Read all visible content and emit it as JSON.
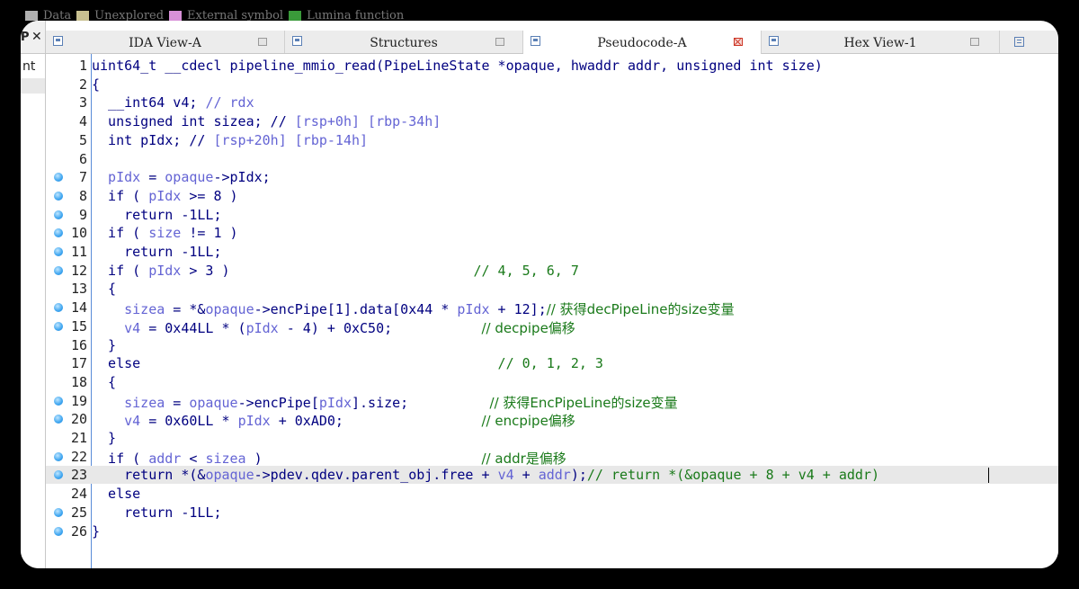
{
  "legend": [
    {
      "label": "Data",
      "color": "#b0b0b0"
    },
    {
      "label": "Unexplored",
      "color": "#c8c090"
    },
    {
      "label": "External symbol",
      "color": "#d890d8"
    },
    {
      "label": "Lumina function",
      "color": "#3a9a3a"
    }
  ],
  "left_pane": {
    "header_p": "P",
    "header_x": "✕",
    "item": "nt"
  },
  "tabs": [
    {
      "label": "IDA View-A",
      "active": false
    },
    {
      "label": "Structures",
      "active": false
    },
    {
      "label": "Pseudocode-A",
      "active": true
    },
    {
      "label": "Hex View-1",
      "active": false
    }
  ],
  "code_lines": [
    {
      "n": "1",
      "bp": false,
      "tokens": [
        [
          "t",
          "uint64_t __cdecl pipeline_mmio_read(PipeLineState *opaque, hwaddr addr, unsigned int size)"
        ]
      ]
    },
    {
      "n": "2",
      "bp": false,
      "tokens": [
        [
          "t",
          "{"
        ]
      ]
    },
    {
      "n": "3",
      "bp": false,
      "tokens": [
        [
          "t",
          "  __int64 v4; "
        ],
        [
          "v",
          "// rdx"
        ]
      ]
    },
    {
      "n": "4",
      "bp": false,
      "tokens": [
        [
          "t",
          "  unsigned int sizea; // "
        ],
        [
          "v",
          "[rsp+0h] [rbp-34h]"
        ]
      ]
    },
    {
      "n": "5",
      "bp": false,
      "tokens": [
        [
          "t",
          "  int pIdx; // "
        ],
        [
          "v",
          "[rsp+20h] [rbp-14h]"
        ]
      ]
    },
    {
      "n": "6",
      "bp": false,
      "tokens": [
        [
          "t",
          ""
        ]
      ]
    },
    {
      "n": "7",
      "bp": true,
      "tokens": [
        [
          "v",
          "  pIdx"
        ],
        [
          "t",
          " = "
        ],
        [
          "v",
          "opaque"
        ],
        [
          "t",
          "->pIdx;"
        ]
      ]
    },
    {
      "n": "8",
      "bp": true,
      "tokens": [
        [
          "t",
          "  if ( "
        ],
        [
          "v",
          "pIdx"
        ],
        [
          "t",
          " >= 8 )"
        ]
      ]
    },
    {
      "n": "9",
      "bp": true,
      "tokens": [
        [
          "t",
          "    return -1LL;"
        ]
      ]
    },
    {
      "n": "10",
      "bp": true,
      "tokens": [
        [
          "t",
          "  if ( "
        ],
        [
          "v",
          "size"
        ],
        [
          "t",
          " != 1 )"
        ]
      ]
    },
    {
      "n": "11",
      "bp": true,
      "tokens": [
        [
          "t",
          "    return -1LL;"
        ]
      ]
    },
    {
      "n": "12",
      "bp": true,
      "tokens": [
        [
          "t",
          "  if ( "
        ],
        [
          "v",
          "pIdx"
        ],
        [
          "t",
          " > 3 )                              "
        ],
        [
          "c",
          "// 4, 5, 6, 7"
        ]
      ]
    },
    {
      "n": "13",
      "bp": false,
      "tokens": [
        [
          "t",
          "  {"
        ]
      ]
    },
    {
      "n": "14",
      "bp": true,
      "tokens": [
        [
          "v",
          "    sizea"
        ],
        [
          "t",
          " = *&"
        ],
        [
          "v",
          "opaque"
        ],
        [
          "t",
          "->encPipe[1].data[0x44 * "
        ],
        [
          "v",
          "pIdx"
        ],
        [
          "t",
          " + 12];"
        ],
        [
          "c",
          "// 获得decPipeLine的size变量"
        ]
      ]
    },
    {
      "n": "15",
      "bp": true,
      "tokens": [
        [
          "v",
          "    v4"
        ],
        [
          "t",
          " = 0x44LL * ("
        ],
        [
          "v",
          "pIdx"
        ],
        [
          "t",
          " - 4) + 0xC50;           "
        ],
        [
          "c",
          "// decpipe偏移"
        ]
      ]
    },
    {
      "n": "16",
      "bp": false,
      "tokens": [
        [
          "t",
          "  }"
        ]
      ]
    },
    {
      "n": "17",
      "bp": false,
      "tokens": [
        [
          "t",
          "  else                                            "
        ],
        [
          "c",
          "// 0, 1, 2, 3"
        ]
      ]
    },
    {
      "n": "18",
      "bp": false,
      "tokens": [
        [
          "t",
          "  {"
        ]
      ]
    },
    {
      "n": "19",
      "bp": true,
      "tokens": [
        [
          "v",
          "    sizea"
        ],
        [
          "t",
          " = "
        ],
        [
          "v",
          "opaque"
        ],
        [
          "t",
          "->encPipe["
        ],
        [
          "v",
          "pIdx"
        ],
        [
          "t",
          "].size;          "
        ],
        [
          "c",
          "// 获得EncPipeLine的size变量"
        ]
      ]
    },
    {
      "n": "20",
      "bp": true,
      "tokens": [
        [
          "v",
          "    v4"
        ],
        [
          "t",
          " = 0x60LL * "
        ],
        [
          "v",
          "pIdx"
        ],
        [
          "t",
          " + 0xAD0;                 "
        ],
        [
          "c",
          "// encpipe偏移"
        ]
      ]
    },
    {
      "n": "21",
      "bp": false,
      "tokens": [
        [
          "t",
          "  }"
        ]
      ]
    },
    {
      "n": "22",
      "bp": true,
      "tokens": [
        [
          "t",
          "  if ( "
        ],
        [
          "v",
          "addr"
        ],
        [
          "t",
          " < "
        ],
        [
          "v",
          "sizea"
        ],
        [
          "t",
          " )                           "
        ],
        [
          "c",
          "// addr是偏移"
        ]
      ]
    },
    {
      "n": "23",
      "bp": true,
      "cur": true,
      "tokens": [
        [
          "t",
          "    return *(&"
        ],
        [
          "v",
          "opaque"
        ],
        [
          "t",
          "->pdev.qdev.parent_obj.free + "
        ],
        [
          "v",
          "v4"
        ],
        [
          "t",
          " + "
        ],
        [
          "v",
          "addr"
        ],
        [
          "t",
          ");"
        ],
        [
          "c",
          "// return *(&opaque + 8 + v4 + addr)"
        ]
      ]
    },
    {
      "n": "24",
      "bp": false,
      "tokens": [
        [
          "t",
          "  else"
        ]
      ]
    },
    {
      "n": "25",
      "bp": true,
      "tokens": [
        [
          "t",
          "    return -1LL;"
        ]
      ]
    },
    {
      "n": "26",
      "bp": true,
      "tokens": [
        [
          "t",
          "}"
        ]
      ]
    }
  ]
}
